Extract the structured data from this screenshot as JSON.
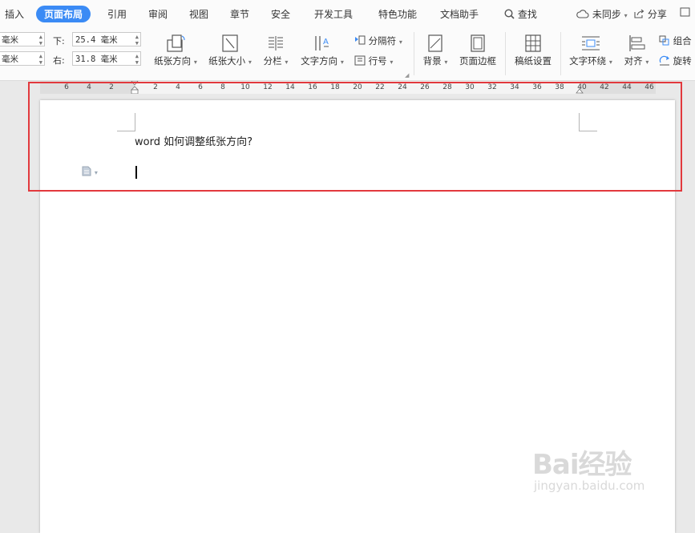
{
  "menubar": {
    "tabs": [
      "插入",
      "页面布局",
      "引用",
      "审阅",
      "视图",
      "章节",
      "安全",
      "开发工具",
      "特色功能",
      "文档助手"
    ],
    "active_tab": "页面布局",
    "search": "查找",
    "sync": "未同步",
    "share": "分享",
    "accent_color": "#3b8bf5"
  },
  "ribbon": {
    "margins": {
      "left_unit_top": "毫米",
      "left_unit_bottom": "毫米",
      "bottom_label": "下:",
      "bottom_value": "25.4 毫米",
      "right_label": "右:",
      "right_value": "31.8 毫米"
    },
    "buttons": {
      "orientation": "纸张方向",
      "size": "纸张大小",
      "columns": "分栏",
      "text_direction": "文字方向",
      "separator": "分隔符",
      "line_number": "行号",
      "background": "背景",
      "page_border": "页面边框",
      "draft_paper": "稿纸设置",
      "wrap_text": "文字环绕",
      "align": "对齐",
      "group": "组合",
      "rotate": "旋转"
    }
  },
  "ruler": {
    "ticks": [
      "6",
      "4",
      "2",
      "2",
      "4",
      "6",
      "8",
      "10",
      "12",
      "14",
      "16",
      "18",
      "20",
      "22",
      "24",
      "26",
      "28",
      "30",
      "32",
      "34",
      "36",
      "38",
      "40",
      "42",
      "44",
      "46"
    ]
  },
  "document": {
    "text": "word 如何调整纸张方向?"
  },
  "highlight_color": "#e2393d",
  "watermark": {
    "main": "Bai经验",
    "sub": "jingyan.baidu.com"
  }
}
